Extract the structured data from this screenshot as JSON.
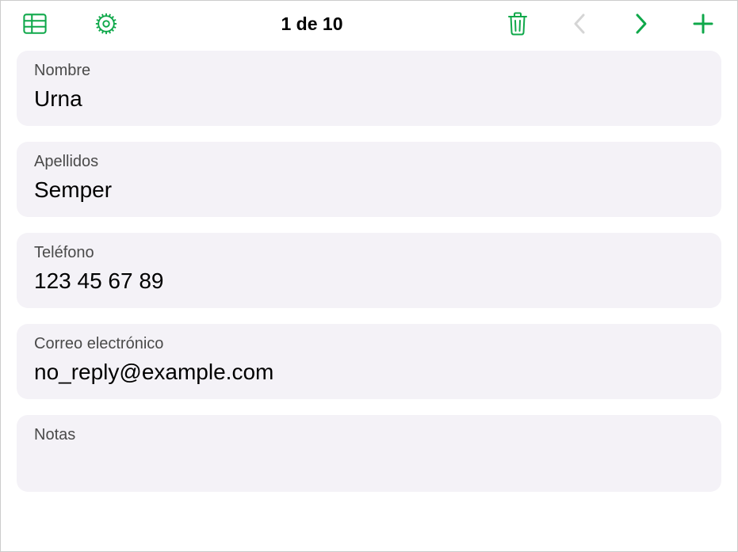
{
  "toolbar": {
    "counter": "1 de 10"
  },
  "colors": {
    "accent": "#1db954",
    "accentStroke": "#0fa84a",
    "disabled": "#b8b8b8"
  },
  "fields": [
    {
      "label": "Nombre",
      "value": "Urna"
    },
    {
      "label": "Apellidos",
      "value": "Semper"
    },
    {
      "label": "Teléfono",
      "value": "123 45 67 89"
    },
    {
      "label": "Correo electrónico",
      "value": "no_reply@example.com"
    },
    {
      "label": "Notas",
      "value": ""
    }
  ]
}
